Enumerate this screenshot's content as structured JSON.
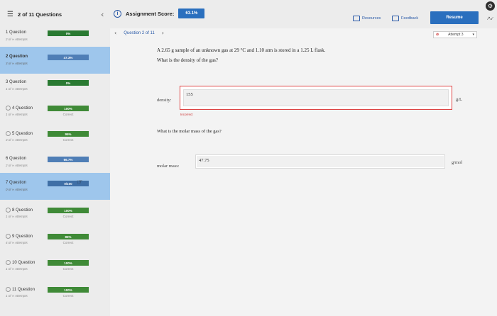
{
  "header": {
    "question_count": "2 of 11 Questions",
    "score_label": "Assignment Score:",
    "score_value": "63.1%",
    "resources_label": "Resources",
    "feedback_label": "Feedback",
    "resume_label": "Resume"
  },
  "sidebar": {
    "items": [
      {
        "title": "1 Question",
        "sub": "2 of ∞ Attempts",
        "badge": "0%",
        "status": ""
      },
      {
        "title": "2 Question",
        "sub": "3 of ∞ Attempts",
        "badge": "47.3%",
        "status": ""
      },
      {
        "title": "3 Question",
        "sub": "1 of ∞ Attempts",
        "badge": "0%",
        "status": ""
      },
      {
        "title": "4 Question",
        "sub": "1 of ∞ Attempts",
        "badge": "100%",
        "status": "Correct"
      },
      {
        "title": "5 Question",
        "sub": "3 of ∞ Attempts",
        "badge": "95%",
        "status": "Correct"
      },
      {
        "title": "6 Question",
        "sub": "2 of ∞ Attempts",
        "badge": "66.7%",
        "status": ""
      },
      {
        "title": "7 Question",
        "sub": "0 of ∞ Attempts",
        "badge": "0/100",
        "status": ""
      },
      {
        "title": "8 Question",
        "sub": "1 of ∞ Attempts",
        "badge": "100%",
        "status": "Correct"
      },
      {
        "title": "9 Question",
        "sub": "4 of ∞ Attempts",
        "badge": "85%",
        "status": "Correct"
      },
      {
        "title": "10 Question",
        "sub": "1 of ∞ Attempts",
        "badge": "100%",
        "status": "Correct"
      },
      {
        "title": "11 Question",
        "sub": "1 of ∞ Attempts",
        "badge": "100%",
        "status": "Correct"
      }
    ]
  },
  "main": {
    "nav_label": "Question 2 of 11",
    "attempt_label": "Attempt 3",
    "question_line1": "A 2.65 g sample of an unknown gas at 29 °C and 1.10 atm is stored in a 1.25 L flask.",
    "question_line2": "What is the density of the gas?",
    "density_label": "density:",
    "density_value": "155",
    "density_unit": "g/L",
    "density_status": "Incorrect",
    "molar_question": "What is the molar mass of the gas?",
    "molar_label": "molar mass:",
    "molar_value": "47.75",
    "molar_unit": "g/mol"
  }
}
